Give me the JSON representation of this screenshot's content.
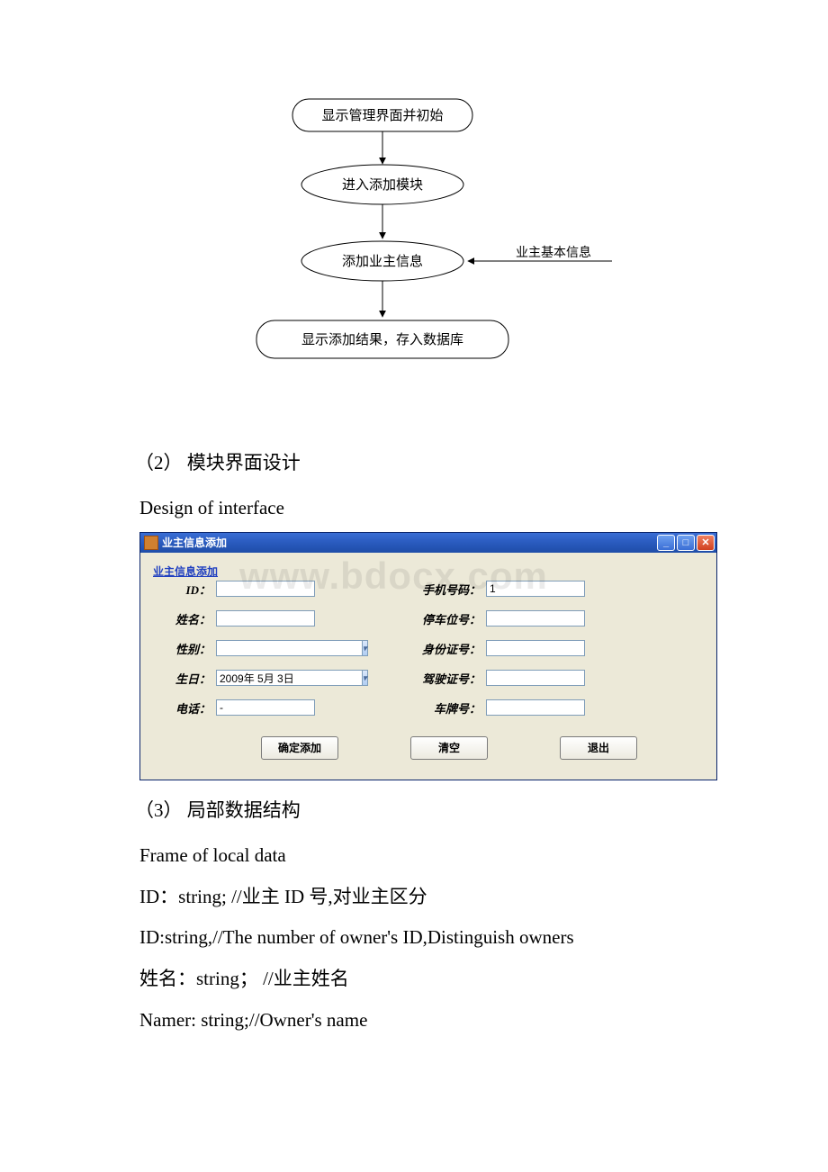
{
  "flowchart": {
    "node1": "显示管理界面并初始",
    "node2": "进入添加模块",
    "node3": "添加业主信息",
    "node3_side": "业主基本信息",
    "node4": "显示添加结果，存入数据库"
  },
  "section2_title": "（2） 模块界面设计",
  "section2_sub": "Design of interface",
  "window": {
    "title": "业主信息添加",
    "group_label": "业主信息添加",
    "watermark": "www.bdocx.com",
    "labels": {
      "id": "ID：",
      "name": "姓名：",
      "gender": "性别：",
      "birthday": "生日：",
      "phone": "电话：",
      "mobile": "手机号码：",
      "parking": "停车位号：",
      "idcard": "身份证号：",
      "license": "驾驶证号：",
      "plate": "车牌号："
    },
    "values": {
      "id": "",
      "name": "",
      "gender": "",
      "birthday": "2009年 5月 3日",
      "phone": "-",
      "mobile": "1",
      "parking": "",
      "idcard": "",
      "license": "",
      "plate": ""
    },
    "buttons": {
      "confirm": "确定添加",
      "clear": "清空",
      "exit": "退出"
    }
  },
  "section3_title": "（3） 局部数据结构",
  "section3_sub": "Frame of local data",
  "code": {
    "l1": "ID：string; //业主 ID 号,对业主区分",
    "l2": "ID:string,//The number of owner's ID,Distinguish owners",
    "l3": "姓名：string；  //业主姓名",
    "l4": "Namer: string;//Owner's name"
  }
}
